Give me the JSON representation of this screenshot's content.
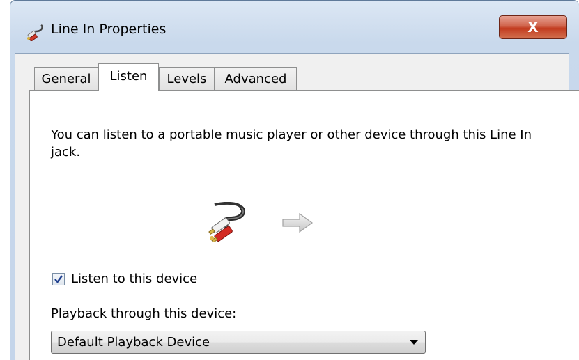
{
  "window": {
    "title": "Line In Properties",
    "close_label": "X",
    "title_icon": "line-in-jack-icon"
  },
  "tabs": [
    {
      "label": "General",
      "active": false
    },
    {
      "label": "Listen",
      "active": true
    },
    {
      "label": "Levels",
      "active": false
    },
    {
      "label": "Advanced",
      "active": false
    }
  ],
  "listen": {
    "description": "You can listen to a portable music player or other device through this Line In jack.",
    "jack_icon": "rca-cable-icon",
    "arrow_icon": "arrow-right-icon",
    "listen_checkbox": {
      "label": "Listen to this device",
      "checked": true
    },
    "playback_label": "Playback through this device:",
    "playback_select": {
      "value": "Default Playback Device"
    }
  },
  "colors": {
    "close_button": "#c23b1f",
    "titlebar": "#c9d9ec",
    "checkmark": "#1f3f8f"
  }
}
